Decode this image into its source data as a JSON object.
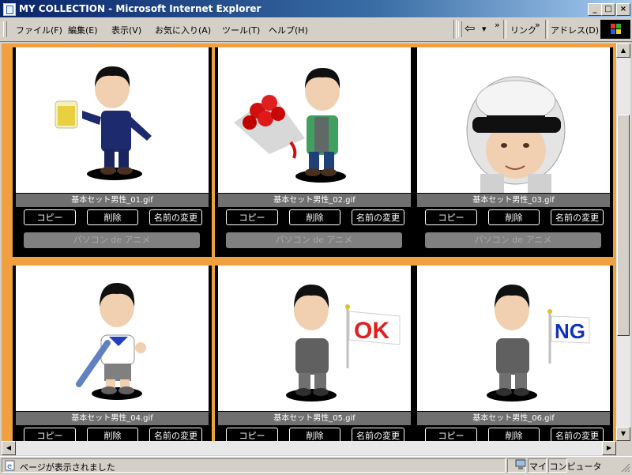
{
  "window": {
    "title": "MY COLLECTION - Microsoft Internet Explorer",
    "minimize": "_",
    "maximize": "□",
    "close": "×"
  },
  "menu": [
    {
      "label": "ファイル(F)"
    },
    {
      "label": "編集(E)"
    },
    {
      "label": "表示(V)"
    },
    {
      "label": "お気に入り(A)"
    },
    {
      "label": "ツール(T)"
    },
    {
      "label": "ヘルプ(H)"
    }
  ],
  "toolbar": {
    "back_arrow": "⇦",
    "dropdown": "▾",
    "chevron1": "»",
    "links_label": "リンク",
    "chevron2": "»",
    "address_label": "アドレス(D)"
  },
  "cards": [
    {
      "filename": "基本セット男性_01.gif",
      "copy": "コピー",
      "delete": "削除",
      "rename": "名前の変更",
      "anime": "パソコン de アニメ"
    },
    {
      "filename": "基本セット男性_02.gif",
      "copy": "コピー",
      "delete": "削除",
      "rename": "名前の変更",
      "anime": "パソコン de アニメ"
    },
    {
      "filename": "基本セット男性_03.gif",
      "copy": "コピー",
      "delete": "削除",
      "rename": "名前の変更",
      "anime": "パソコン de アニメ"
    },
    {
      "filename": "基本セット男性_04.gif",
      "copy": "コピー",
      "delete": "削除",
      "rename": "名前の変更",
      "anime": ""
    },
    {
      "filename": "基本セット男性_05.gif",
      "copy": "コピー",
      "delete": "削除",
      "rename": "名前の変更",
      "anime": ""
    },
    {
      "filename": "基本セット男性_06.gif",
      "copy": "コピー",
      "delete": "削除",
      "rename": "名前の変更",
      "anime": ""
    }
  ],
  "flags": {
    "ok": "OK",
    "ng": "NG"
  },
  "scroll": {
    "up": "▲",
    "down": "▼",
    "left": "◀",
    "right": "▶"
  },
  "status": {
    "message": "ページが表示されました",
    "zone": "マイ コンピュータ"
  },
  "colors": {
    "page_bg": "#f0a040",
    "card_bg": "#000000",
    "title_bar": "#0a246a"
  }
}
